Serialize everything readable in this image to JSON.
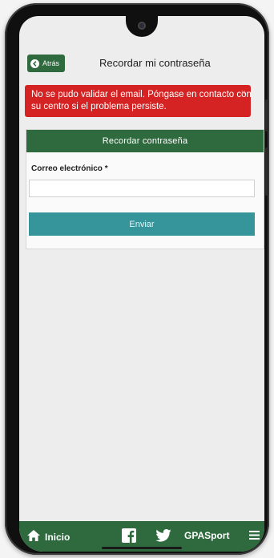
{
  "header": {
    "back_label": "Atrás",
    "title": "Recordar mi contraseña"
  },
  "alert": {
    "message": "No se pudo validar el email. Póngase en contacto con su centro si el problema persiste.",
    "close_glyph": "×"
  },
  "form": {
    "panel_title": "Recordar contraseña",
    "email_label": "Correo electrónico *",
    "email_value": "",
    "email_placeholder": "",
    "submit_label": "Enviar"
  },
  "footer": {
    "home_label": "Inicio",
    "brand_label": "GPASport",
    "icons": [
      "home-icon",
      "facebook-icon",
      "twitter-icon",
      "menu-icon"
    ]
  },
  "colors": {
    "primary_green": "#2e6a3d",
    "alert_red": "#d52323",
    "button_teal": "#35959a"
  }
}
